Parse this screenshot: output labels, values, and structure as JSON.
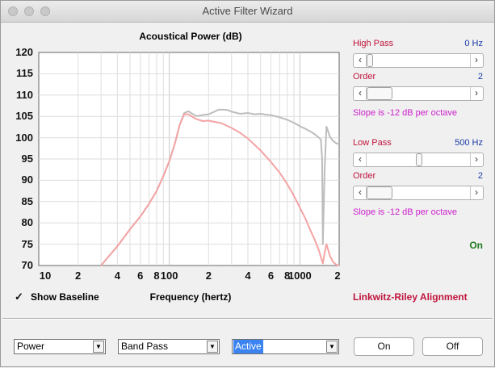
{
  "window": {
    "title": "Active Filter Wizard"
  },
  "chart_data": {
    "type": "line",
    "title": "Acoustical Power (dB)",
    "xlabel": "Frequency (hertz)",
    "ylabel": "",
    "xscale": "log",
    "xlim": [
      10,
      2000
    ],
    "ylim": [
      70,
      120
    ],
    "grid": true,
    "yticks": [
      "120",
      "115",
      "110",
      "105",
      "100",
      "95",
      "90",
      "85",
      "80",
      "75",
      "70"
    ],
    "xticks": [
      "10",
      "2",
      "4",
      "6",
      "8",
      "100",
      "2",
      "4",
      "6",
      "8",
      "1000",
      "2"
    ],
    "series": [
      {
        "color": "#bdbdbd",
        "x": [
          30,
          40,
          50,
          60,
          70,
          80,
          90,
          100,
          110,
          120,
          130,
          140,
          160,
          180,
          200,
          240,
          280,
          300,
          350,
          400,
          450,
          500,
          550,
          600,
          700,
          800,
          900,
          1000,
          1100,
          1200,
          1300,
          1400,
          1450,
          1480,
          1500,
          1550,
          1600,
          1700,
          1800,
          1900,
          2000
        ],
        "y": [
          70,
          74.5,
          78.5,
          81.5,
          84.5,
          87.5,
          91,
          94.5,
          98.5,
          103,
          105.8,
          106.2,
          105.1,
          105.3,
          105.5,
          106.6,
          106.5,
          106.1,
          105.6,
          105.8,
          105.5,
          105.6,
          105.4,
          105.3,
          104.8,
          104.2,
          103.5,
          102.7,
          102.1,
          101.5,
          100.8,
          100,
          99.5,
          95,
          75,
          93,
          102.6,
          100.2,
          99.2,
          98.7,
          98.5
        ]
      },
      {
        "color": "#f4a4a4",
        "x": [
          30,
          40,
          50,
          60,
          70,
          80,
          90,
          100,
          110,
          120,
          130,
          140,
          160,
          180,
          200,
          250,
          300,
          350,
          400,
          500,
          600,
          700,
          800,
          900,
          1000,
          1100,
          1200,
          1300,
          1400,
          1450,
          1480,
          1500,
          1550,
          1600,
          1700,
          1800,
          1900,
          2000
        ],
        "y": [
          70,
          74.5,
          78.5,
          81.5,
          84.5,
          87.5,
          91,
          94.5,
          98.5,
          103,
          105.5,
          105.5,
          104.4,
          103.9,
          104,
          103.4,
          102.3,
          101.1,
          99.8,
          97,
          94.3,
          91.8,
          89.1,
          86.4,
          83.6,
          81.1,
          78.4,
          76,
          73.5,
          72,
          71,
          70.5,
          73,
          75,
          72.3,
          70.8,
          70.2,
          70
        ]
      }
    ]
  },
  "baseline": {
    "checked": true,
    "label": "Show Baseline"
  },
  "highpass": {
    "label": "High Pass",
    "value": "0 Hz",
    "position": 0.0
  },
  "highpass_order": {
    "label": "Order",
    "value": "2",
    "position": 0.25
  },
  "highpass_slope": "Slope is -12 dB per octave",
  "lowpass": {
    "label": "Low Pass",
    "value": "500 Hz",
    "position": 0.5
  },
  "lowpass_order": {
    "label": "Order",
    "value": "2",
    "position": 0.25
  },
  "lowpass_slope": "Slope is -12 dB per octave",
  "status": "On",
  "alignment": "Linkwitz-Riley Alignment",
  "selects": {
    "mode": "Power",
    "filter": "Band Pass",
    "type": "Active"
  },
  "buttons": {
    "on": "On",
    "off": "Off"
  },
  "colors": {
    "accent_red": "#c0143c",
    "value_blue": "#1a3aa8",
    "slope_magenta": "#cc1fcc",
    "status_green": "#1f7a1f",
    "select_highlight": "#3a83f0"
  }
}
